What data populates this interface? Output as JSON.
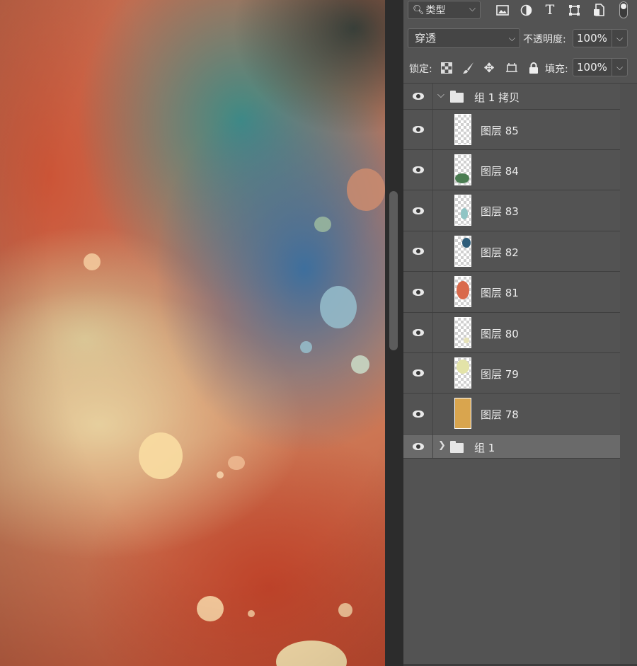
{
  "filter": {
    "label": "类型",
    "icons": [
      "search-icon",
      "image-filter-icon",
      "adjustment-filter-icon",
      "type-filter-icon",
      "shape-filter-icon",
      "smart-object-filter-icon"
    ]
  },
  "blend": {
    "mode": "穿透",
    "opacity_label": "不透明度:",
    "opacity_value": "100%"
  },
  "lock": {
    "label": "锁定:",
    "fill_label": "填充:",
    "fill_value": "100%",
    "icons": [
      "lock-transparent-pixels-icon",
      "lock-image-pixels-icon",
      "lock-position-icon",
      "lock-artboard-icon",
      "lock-all-icon"
    ]
  },
  "layers": [
    {
      "name": "组 1 拷贝",
      "type": "group",
      "expanded": true,
      "visible": true
    },
    {
      "name": "图层 85",
      "type": "layer",
      "visible": true
    },
    {
      "name": "图层 84",
      "type": "layer",
      "visible": true
    },
    {
      "name": "图层 83",
      "type": "layer",
      "visible": true
    },
    {
      "name": "图层 82",
      "type": "layer",
      "visible": true
    },
    {
      "name": "图层 81",
      "type": "layer",
      "visible": true
    },
    {
      "name": "图层 80",
      "type": "layer",
      "visible": true
    },
    {
      "name": "图层 79",
      "type": "layer",
      "visible": true
    },
    {
      "name": "图层 78",
      "type": "layer",
      "visible": true
    },
    {
      "name": "组 1",
      "type": "group",
      "expanded": false,
      "visible": true,
      "selected": true
    }
  ],
  "colors": {
    "panel_bg": "#535353",
    "selected_row": "#6a6a6a",
    "canvas_bg": "#2b2b2b"
  }
}
